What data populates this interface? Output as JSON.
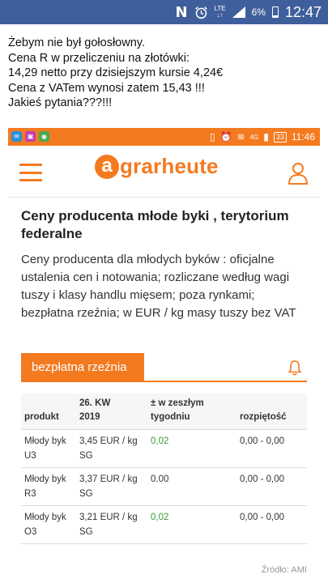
{
  "status_bar": {
    "time": "12:47",
    "battery_percent": "6%",
    "network": "LTE",
    "notification_letter": "N"
  },
  "message": {
    "lines": [
      "Żebym nie był gołosłowny.",
      "Cena R w przeliczeniu na złotówki:",
      "14,29 netto przy dzisiejszym kursie 4,24€",
      "Cena z VATem wynosi zatem 15,43 !!!",
      "Jakieś pytania???!!!"
    ]
  },
  "embedded": {
    "status_bar": {
      "time": "11:46",
      "battery": "33",
      "network": "4G",
      "accent": "#f47a20"
    },
    "header": {
      "logo_letter": "a",
      "logo_rest": "grarheute",
      "brand_color": "#f47a20"
    },
    "article": {
      "title": "Ceny producenta młode byki , terytorium federalne",
      "description": "Ceny producenta dla młodych byków : oficjalne ustalenia cen i notowania; rozliczane według wagi tuszy i klasy handlu mięsem; poza rynkami; bezpłatna rzeźnia; w EUR / kg masy tuszy bez VAT"
    },
    "tab": {
      "label": "bezpłatna rzeźnia"
    },
    "table": {
      "headers": {
        "product": "produkt",
        "kw_line1": "26. KW",
        "kw_line2": "2019",
        "change_line1": "± w zeszłym",
        "change_line2": "tygodniu",
        "range": "rozpiętość"
      },
      "rows": [
        {
          "product": "Młody byk U3",
          "price": "3,45 EUR / kg SG",
          "change": "0,02",
          "range": "0,00 - 0,00"
        },
        {
          "product": "Młody byk R3",
          "price": "3,37 EUR / kg SG",
          "change": "0.00",
          "range": "0,00 - 0,00"
        },
        {
          "product": "Młody byk O3",
          "price": "3,21 EUR / kg SG",
          "change": "0,02",
          "range": "0,00 - 0,00"
        }
      ]
    },
    "source": "Źródło: AMI"
  }
}
